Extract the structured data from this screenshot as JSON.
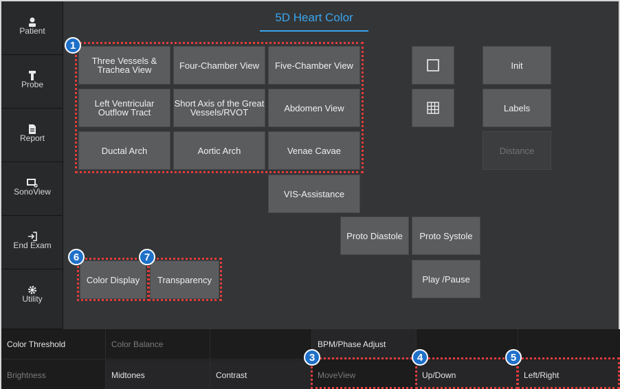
{
  "title": "5D Heart Color",
  "sidebar": {
    "items": [
      {
        "label": "Patient",
        "icon": "person-icon"
      },
      {
        "label": "Probe",
        "icon": "probe-icon"
      },
      {
        "label": "Report",
        "icon": "document-icon"
      },
      {
        "label": "SonoView",
        "icon": "sonoview-icon"
      },
      {
        "label": "End Exam",
        "icon": "exit-icon"
      },
      {
        "label": "Utility",
        "icon": "gear-icon"
      }
    ]
  },
  "views": {
    "three_vessels": "Three Vessels & Trachea View",
    "four_chamber": "Four-Chamber View",
    "five_chamber": "Five-Chamber View",
    "lvot": "Left Ventricular Outflow Tract",
    "short_axis": "Short Axis of the Great Vessels/RVOT",
    "abdomen": "Abdomen View",
    "ductal_arch": "Ductal Arch",
    "aortic_arch": "Aortic Arch",
    "venae_cavae": "Venae Cavae",
    "vis_assistance": "VIS-Assistance"
  },
  "controls": {
    "proto_diastole": "Proto Diastole",
    "proto_systole": "Proto Systole",
    "play_pause": "Play /Pause",
    "init": "Init",
    "labels": "Labels",
    "distance": "Distance",
    "color_display": "Color Display",
    "transparency": "Transparency"
  },
  "bottom": {
    "row1": [
      "Color Threshold",
      "Color Balance",
      "",
      "BPM/Phase Adjust",
      "",
      ""
    ],
    "row2": [
      "Brightness",
      "Midtones",
      "Contrast",
      "MoveView",
      "Up/Down",
      "Left/Right"
    ]
  },
  "badges": [
    "1",
    "3",
    "4",
    "5",
    "6",
    "7"
  ],
  "colors": {
    "accent": "#39a6f0",
    "annotation": "#e53c3c",
    "badge": "#1f70c9"
  }
}
